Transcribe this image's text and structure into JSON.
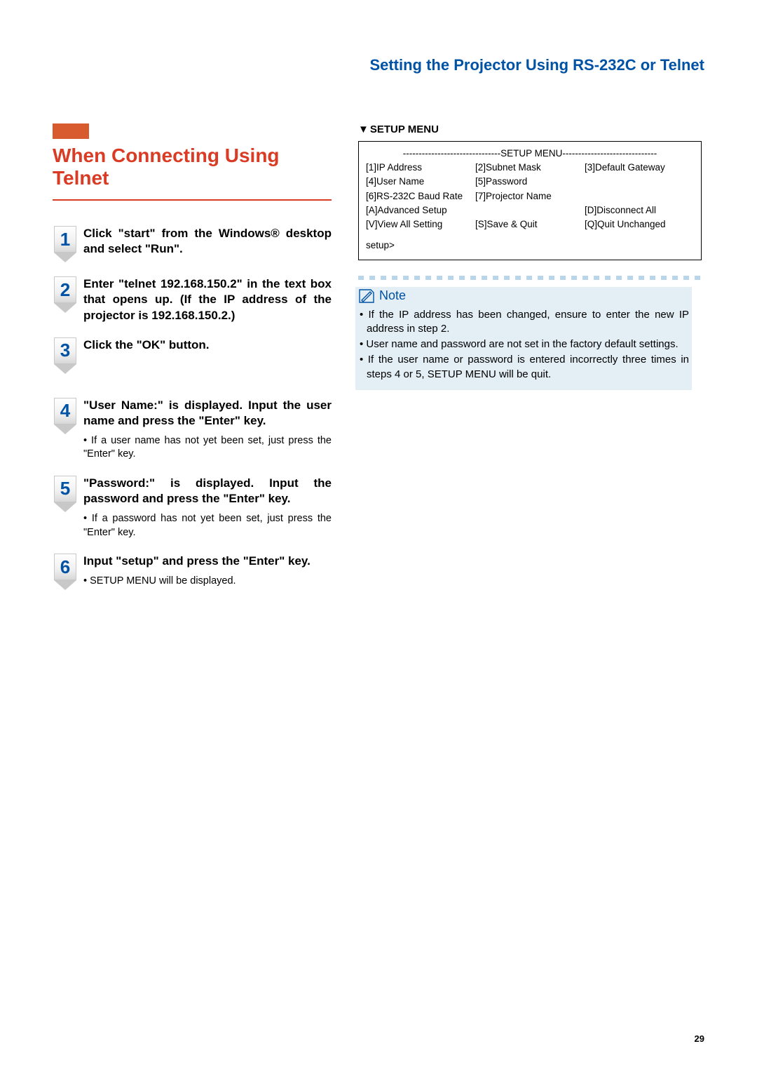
{
  "header": "Setting the Projector Using RS-232C or Telnet",
  "section_title": "When Connecting Using Telnet",
  "steps": [
    {
      "num": "1",
      "main": "Click \"start\" from the Windows® desktop and select \"Run\".",
      "sub": null
    },
    {
      "num": "2",
      "main": "Enter \"telnet 192.168.150.2\" in the text box that opens up. (If the IP address of the projector is 192.168.150.2.)",
      "sub": null
    },
    {
      "num": "3",
      "main": "Click the \"OK\" button.",
      "sub": null
    },
    {
      "num": "4",
      "main": "\"User Name:\" is displayed. Input the user name and press the \"Enter\" key.",
      "sub": "If a user name has not yet been set, just press the \"Enter\" key."
    },
    {
      "num": "5",
      "main": "\"Password:\" is displayed. Input the password and press the \"Enter\" key.",
      "sub": "If a password has not yet been set, just press the \"Enter\" key."
    },
    {
      "num": "6",
      "main": "Input \"setup\" and press the \"Enter\" key.",
      "sub": "SETUP MENU will be displayed."
    }
  ],
  "setup_menu": {
    "label": "SETUP MENU",
    "dash_line": "-------------------------------SETUP MENU------------------------------",
    "rows": [
      [
        "[1]IP Address",
        "[2]Subnet Mask",
        "[3]Default Gateway"
      ],
      [
        "[4]User Name",
        "[5]Password",
        ""
      ],
      [
        "[6]RS-232C Baud Rate",
        "[7]Projector Name",
        ""
      ],
      [
        "[A]Advanced Setup",
        "",
        "[D]Disconnect All"
      ],
      [
        "[V]View All Setting",
        "[S]Save & Quit",
        "[Q]Quit Unchanged"
      ]
    ],
    "prompt": "setup>"
  },
  "note": {
    "label": "Note",
    "items": [
      "If the IP address has been changed, ensure to enter the new IP address in step 2.",
      "User name and password are not set in the factory default settings.",
      "If the user name or password is entered incorrectly three times in steps 4 or 5, SETUP MENU will be quit."
    ]
  },
  "page_number": "29"
}
